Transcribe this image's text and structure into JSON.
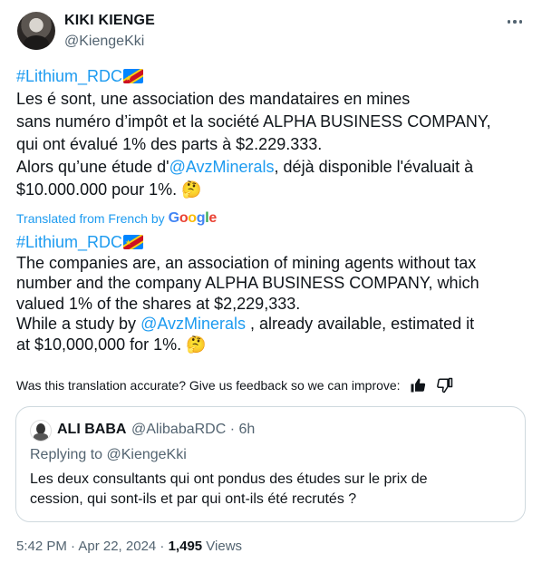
{
  "author": {
    "name": "KIKI KIENGE",
    "handle": "@KiengeKki"
  },
  "original": {
    "hashtag": "#Lithium_RDC",
    "line1": "Les é sont, une association des mandataires en mines",
    "line2": "sans numéro d’impôt et la société ALPHA BUSINESS COMPANY,",
    "line3": "qui ont évalué 1% des parts à $2.229.333.",
    "line4_pre": "Alors qu’une étude d'",
    "line4_mention": "@AvzMinerals",
    "line4_post": ", déjà disponible l'évaluait à",
    "line5": "$10.000.000 pour 1%. ",
    "emoji": "🤔"
  },
  "translation": {
    "label": "Translated from French by",
    "provider": {
      "g1": "G",
      "g2": "o",
      "g3": "o",
      "g4": "g",
      "g5": "l",
      "g6": "e"
    },
    "hashtag": "#Lithium_RDC",
    "line1": "The companies are, an association of mining agents without tax",
    "line2": "number and the company ALPHA BUSINESS COMPANY, which",
    "line3": "valued 1% of the shares at $2,229,333.",
    "line4_pre": "While a study by ",
    "line4_mention": "@AvzMinerals",
    "line4_post": " , already available, estimated it",
    "line5": "at $10,000,000 for 1%. ",
    "emoji": "🤔"
  },
  "feedback": {
    "question": "Was this translation accurate? Give us feedback so we can improve:"
  },
  "quote": {
    "name": "ALI BABA",
    "handle": "@AlibabaRDC · 6h",
    "replying_label": "Replying to @KiengeKki",
    "text_line1": "Les deux consultants qui ont pondus des études sur le prix de",
    "text_line2": "cession, qui sont-ils et par qui ont-ils été recrutés ?"
  },
  "meta": {
    "time": "5:42 PM · Apr 22, 2024 · ",
    "views_count": "1,495",
    "views_label": " Views"
  },
  "colors": {
    "link": "#1d9bf0",
    "text": "#0f1419",
    "muted": "#536471",
    "border": "#cfd9de"
  }
}
